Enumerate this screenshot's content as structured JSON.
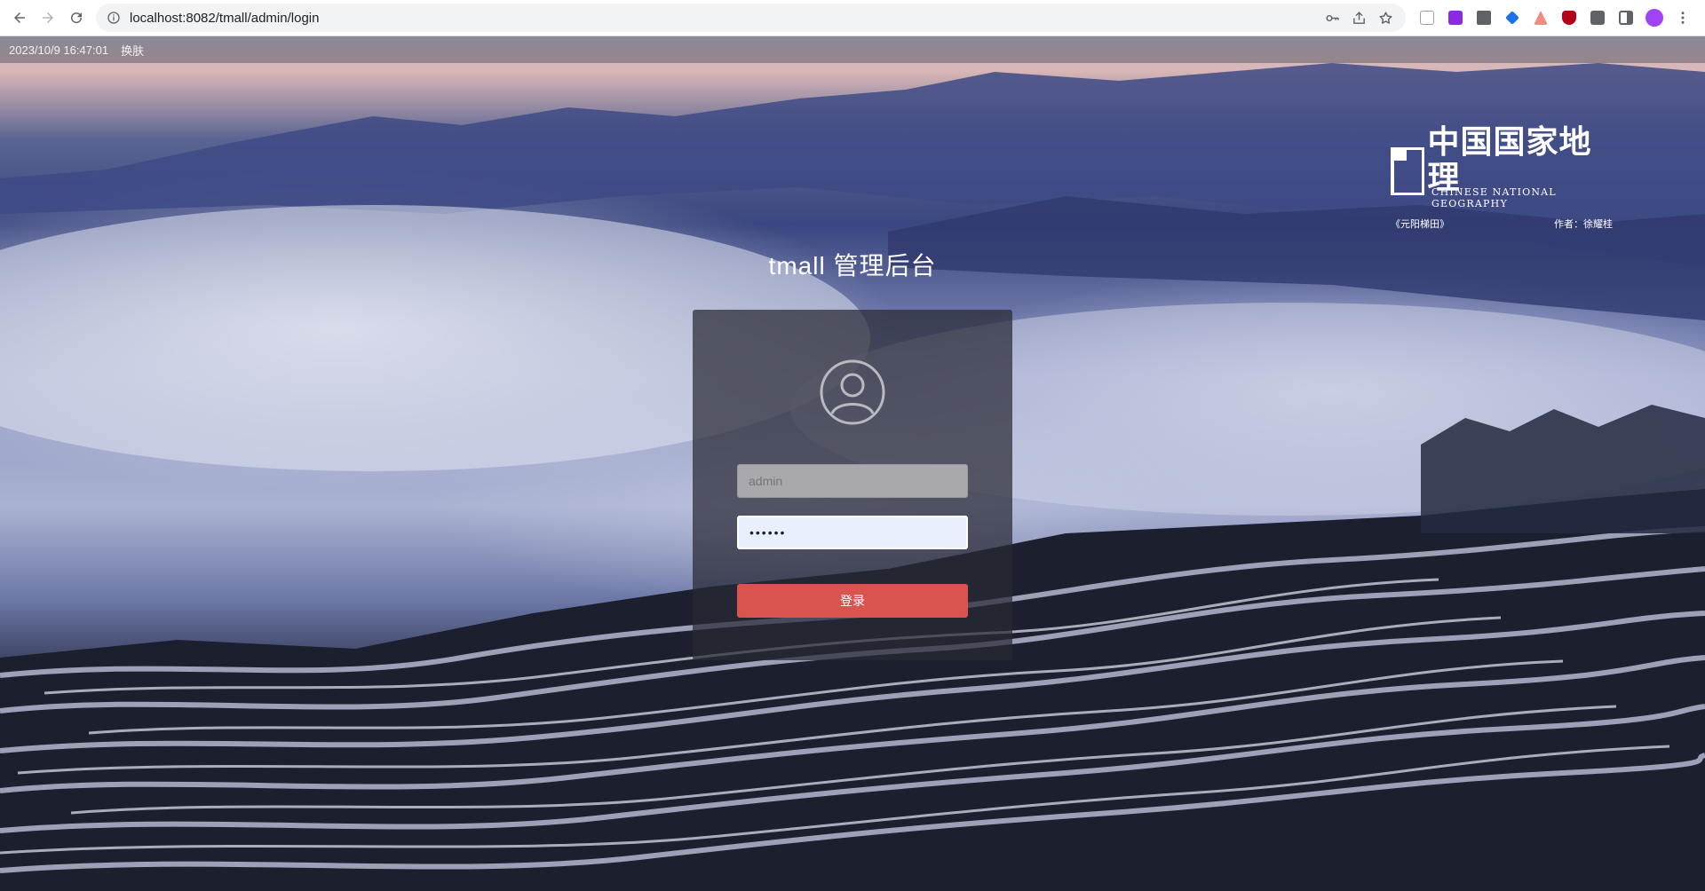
{
  "browser": {
    "url": "localhost:8082/tmall/admin/login"
  },
  "top_bar": {
    "datetime": "2023/10/9 16:47:01",
    "skin_label": "换肤"
  },
  "logo": {
    "chinese": "中国国家地理",
    "english": "CHINESE NATIONAL GEOGRAPHY",
    "caption_left": "《元阳梯田》",
    "caption_right": "作者：徐耀桂"
  },
  "login": {
    "title": "tmall 管理后台",
    "username_placeholder": "admin",
    "password_value": "••••••",
    "submit_label": "登录"
  },
  "colors": {
    "submit_button": "#d9534f",
    "card_background": "rgba(40,42,52,0.72)",
    "password_field": "#e8f0fe"
  }
}
